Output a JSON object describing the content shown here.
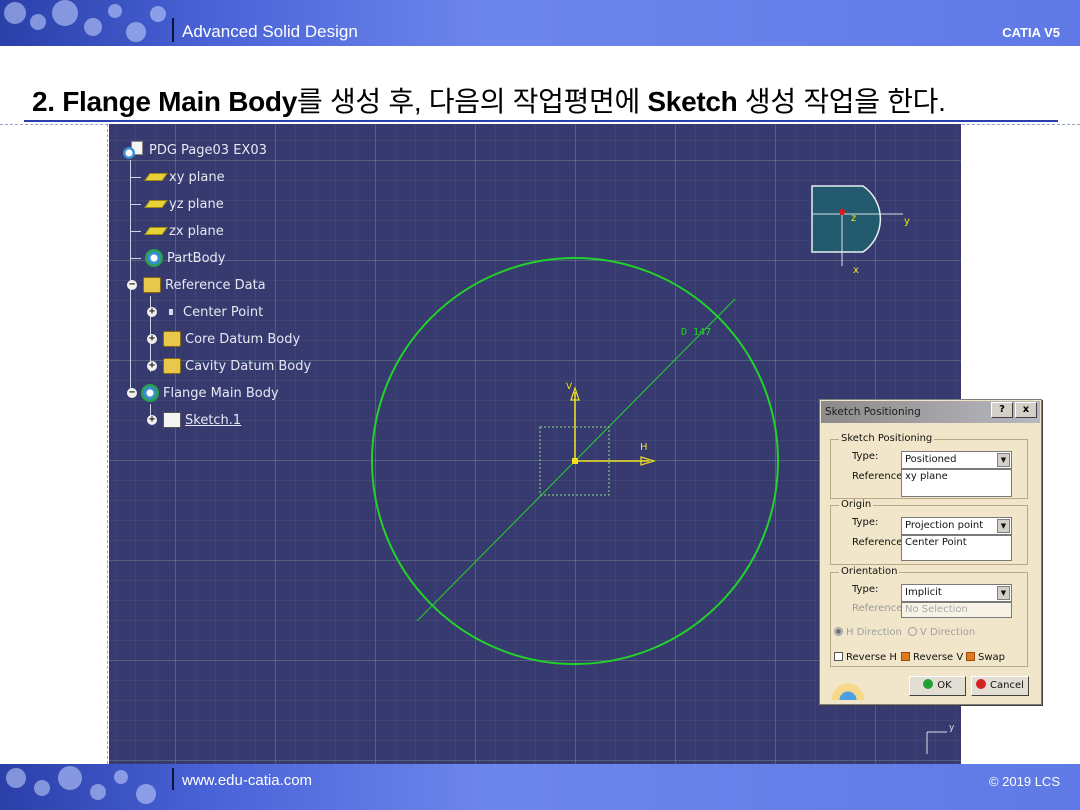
{
  "header": {
    "course_title": "Advanced Solid Design",
    "brand": "CATIA V5"
  },
  "slide": {
    "title_parts": [
      {
        "text": "2. Flange Main Body",
        "bold": true
      },
      {
        "text": "를 생성 후, 다음의 작업평면에 ",
        "bold": false
      },
      {
        "text": "Sketch",
        "bold": true
      },
      {
        "text": " 생성 작업을 한다.",
        "bold": false
      }
    ]
  },
  "tree": {
    "root": "PDG Page03 EX03",
    "items": [
      {
        "label": "xy plane",
        "icon": "plane-icon"
      },
      {
        "label": "yz plane",
        "icon": "plane-icon"
      },
      {
        "label": "zx plane",
        "icon": "plane-icon"
      },
      {
        "label": "PartBody",
        "icon": "gear-icon"
      },
      {
        "label": "Reference Data",
        "icon": "body-icon"
      },
      {
        "label": "Center Point",
        "icon": "point-icon"
      },
      {
        "label": "Core Datum Body",
        "icon": "body-icon"
      },
      {
        "label": "Cavity Datum Body",
        "icon": "body-icon"
      },
      {
        "label": "Flange Main Body",
        "icon": "gear-icon"
      },
      {
        "label": "Sketch.1",
        "icon": "sketch-icon"
      }
    ]
  },
  "viewport": {
    "dimension_label": "D 147",
    "axis_h": "H",
    "axis_v": "V",
    "compass_labels": {
      "z": "z",
      "y": "y",
      "x": "x"
    },
    "triad_label": "y",
    "colors": {
      "background": "#363a6e",
      "circle": "#22d22a",
      "axis": "#f0e020"
    }
  },
  "dialog": {
    "title": "Sketch Positioning",
    "help_button": "?",
    "close_button": "x",
    "sketch_positioning": {
      "group_title": "Sketch Positioning",
      "type_label": "Type:",
      "type_value": "Positioned",
      "reference_label": "Reference:",
      "reference_value": "xy plane"
    },
    "origin": {
      "group_title": "Origin",
      "type_label": "Type:",
      "type_value": "Projection point",
      "reference_label": "Reference:",
      "reference_value": "Center Point"
    },
    "orientation": {
      "group_title": "Orientation",
      "type_label": "Type:",
      "type_value": "Implicit",
      "reference_label": "Reference:",
      "reference_value": "No Selection",
      "h_direction": "H Direction",
      "v_direction": "V Direction"
    },
    "checks": {
      "reverse_h": "Reverse H",
      "reverse_v": "Reverse V",
      "swap": "Swap"
    },
    "ok": "OK",
    "cancel": "Cancel"
  },
  "footer": {
    "url": "www.edu-catia.com",
    "copyright": "© 2019 LCS"
  }
}
